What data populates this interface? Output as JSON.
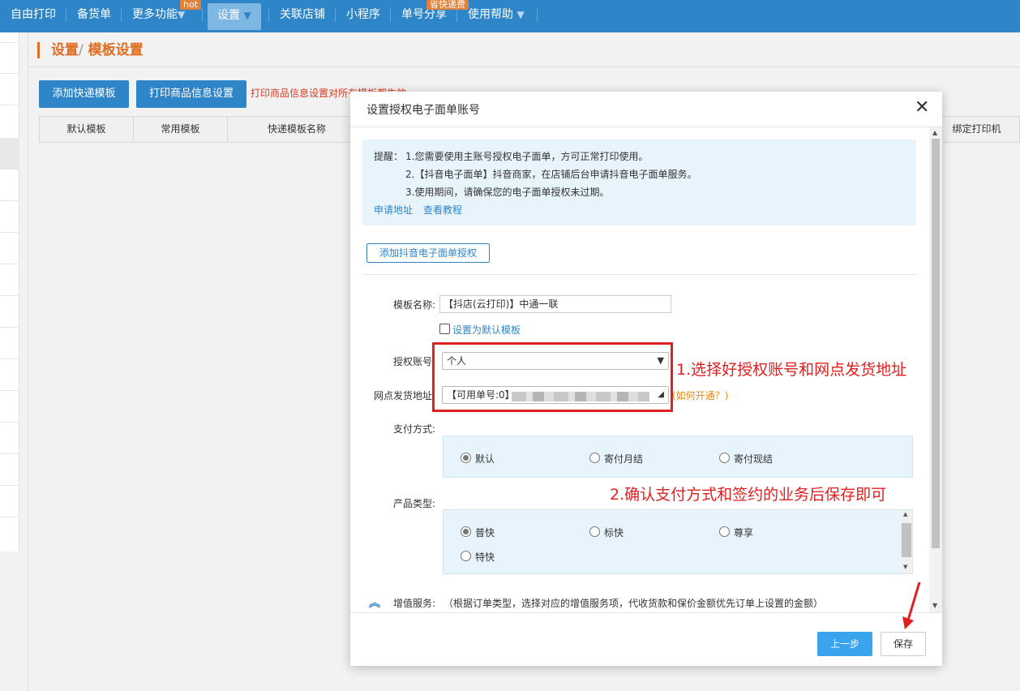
{
  "nav": {
    "items": [
      "自由打印",
      "备货单",
      "更多功能",
      "设置",
      "关联店铺",
      "小程序",
      "单号分享",
      "使用帮助"
    ],
    "hot_badge": "hot",
    "share_badge": "省快递费",
    "dropdown_arrow": "▼"
  },
  "breadcrumb": {
    "root": "设置",
    "sep": "/",
    "current": "模板设置"
  },
  "toolbar": {
    "add_template": "添加快递模板",
    "print_info": "打印商品信息设置",
    "warning": "打印商品信息设置对所有模板都生效"
  },
  "table": {
    "columns": [
      "默认模板",
      "常用模板",
      "快递模板名称",
      "绑定打印机"
    ]
  },
  "modal": {
    "title": "设置授权电子面单账号",
    "close": "✕",
    "tips": {
      "label": "提醒：",
      "line1": "1.您需要使用主账号授权电子面单，方可正常打印使用。",
      "line2": "2.【抖音电子面单】抖音商家，在店铺后台申请抖音电子面单服务。",
      "line3": "3.使用期间，请确保您的电子面单授权未过期。",
      "apply_link": "申请地址",
      "tutorial_link": "查看教程"
    },
    "add_auth_button": "添加抖音电子面单授权",
    "form": {
      "template_name_label": "模板名称:",
      "template_name_value": "【抖店(云打印)】中通一联",
      "default_checkbox_label": "设置为默认模板",
      "auth_account_label": "授权账号:",
      "auth_account_value": "个人",
      "branch_address_label": "网点发货地址:",
      "branch_address_value": "【可用单号:0】",
      "how_to_open": "(如何开通？)",
      "payment_label": "支付方式:",
      "payment_options": [
        "默认",
        "寄付月结",
        "寄付现结"
      ],
      "payment_selected": "默认",
      "product_type_label": "产品类型:",
      "product_options": [
        "普快",
        "标快",
        "尊享",
        "特快"
      ],
      "product_selected": "普快",
      "value_added_label": "增值服务:",
      "value_added_note": "（根据订单类型，选择对应的增值服务项，代收货款和保价金额优先订单上设置的金额）"
    },
    "annotations": {
      "step1": "1.选择好授权账号和网点发货地址",
      "step2": "2.确认支付方式和签约的业务后保存即可"
    },
    "footer": {
      "prev": "上一步",
      "save": "保存"
    }
  },
  "colors": {
    "nav_bg": "#2e86c8",
    "accent_orange": "#e06c1f",
    "annotation_red": "#e02020"
  }
}
